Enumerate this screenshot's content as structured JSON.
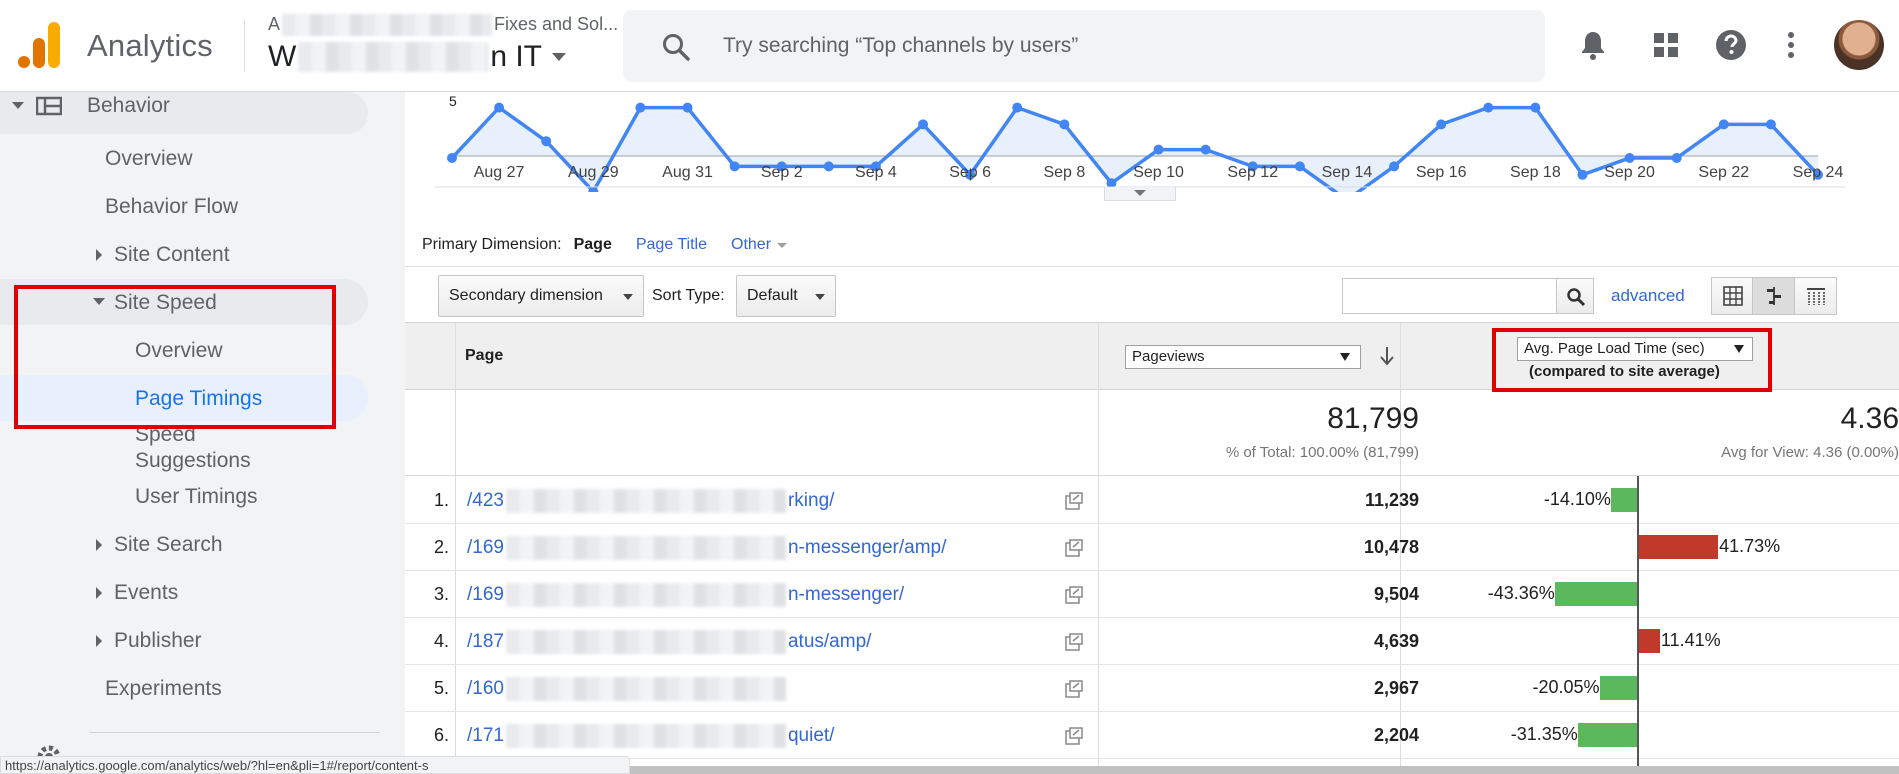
{
  "header": {
    "brand": "Analytics",
    "account_prefix": "A",
    "account_suffix": "Fixes and Sol...",
    "property_prefix": "W",
    "property_suffix": "n IT",
    "search_placeholder": "Try searching “Top channels by users”",
    "icons": [
      "search-icon",
      "bell-icon",
      "apps-icon",
      "help-icon",
      "more-vert-icon"
    ]
  },
  "sidebar": {
    "behavior": "Behavior",
    "overview": "Overview",
    "behavior_flow": "Behavior Flow",
    "site_content": "Site Content",
    "site_speed": "Site Speed",
    "speed_overview": "Overview",
    "page_timings": "Page Timings",
    "speed_suggestions_1": "Speed",
    "speed_suggestions_2": "Suggestions",
    "user_timings": "User Timings",
    "site_search": "Site Search",
    "events": "Events",
    "publisher": "Publisher",
    "experiments": "Experiments"
  },
  "chart_data": {
    "type": "line",
    "x": [
      "Aug 26",
      "Aug 27",
      "Aug 28",
      "Aug 29",
      "Aug 30",
      "Aug 31",
      "Sep 1",
      "Sep 2",
      "Sep 3",
      "Sep 4",
      "Sep 5",
      "Sep 6",
      "Sep 7",
      "Sep 8",
      "Sep 9",
      "Sep 10",
      "Sep 11",
      "Sep 12",
      "Sep 13",
      "Sep 14",
      "Sep 15",
      "Sep 16",
      "Sep 17",
      "Sep 18",
      "Sep 19",
      "Sep 20",
      "Sep 21",
      "Sep 22",
      "Sep 23",
      "Sep 24"
    ],
    "tick_labels": [
      "Aug 27",
      "Aug 29",
      "Aug 31",
      "Sep 2",
      "Sep 4",
      "Sep 6",
      "Sep 8",
      "Sep 10",
      "Sep 12",
      "Sep 14",
      "Sep 16",
      "Sep 18",
      "Sep 20",
      "Sep 22",
      "Sep 24"
    ],
    "y_axis_label": "5",
    "series": [
      {
        "values": [
          5,
          5.6,
          5.2,
          4.6,
          5.6,
          5.6,
          4.9,
          4.9,
          4.9,
          4.9,
          5.4,
          4.8,
          5.6,
          5.4,
          4.7,
          5.1,
          5.1,
          4.9,
          4.9,
          4.5,
          4.9,
          5.4,
          5.6,
          5.6,
          4.8,
          5.0,
          5.0,
          5.4,
          5.4,
          4.8
        ]
      }
    ],
    "ylim": [
      4,
      6
    ],
    "color": "#4285f4",
    "fill": "#e8f0fb",
    "grid": false
  },
  "dimensions": {
    "label": "Primary Dimension:",
    "active": "Page",
    "page_title": "Page Title",
    "other": "Other"
  },
  "controls": {
    "secondary_dimension": "Secondary dimension",
    "sort_type_label": "Sort Type:",
    "sort_type_value": "Default",
    "filter_value": "",
    "advanced": "advanced"
  },
  "table": {
    "col_page": "Page",
    "col_pageviews": "Pageviews",
    "col_metric": "Avg. Page Load Time (sec)",
    "col_metric_sub": "(compared to site average)",
    "total_pageviews": "81,799",
    "total_pageviews_sub": "% of Total: 100.00% (81,799)",
    "total_metric": "4.36",
    "total_metric_sub": "Avg for View: 4.36 (0.00%)",
    "rows": [
      {
        "num": "1.",
        "page_start": "/423",
        "page_end": "rking/",
        "pageviews": "11,239",
        "pct_label": "-14.10%",
        "pct": -14.1
      },
      {
        "num": "2.",
        "page_start": "/169",
        "page_end": "n-messenger/amp/",
        "pageviews": "10,478",
        "pct_label": "41.73%",
        "pct": 41.73
      },
      {
        "num": "3.",
        "page_start": "/169",
        "page_end": "n-messenger/",
        "pageviews": "9,504",
        "pct_label": "-43.36%",
        "pct": -43.36
      },
      {
        "num": "4.",
        "page_start": "/187",
        "page_end": "atus/amp/",
        "pageviews": "4,639",
        "pct_label": "11.41%",
        "pct": 11.41
      },
      {
        "num": "5.",
        "page_start": "/160",
        "page_end": "",
        "pageviews": "2,967",
        "pct_label": "-20.05%",
        "pct": -20.05
      },
      {
        "num": "6.",
        "page_start": "/171",
        "page_end": "quiet/",
        "pageviews": "2,204",
        "pct_label": "-31.35%",
        "pct": -31.35
      }
    ],
    "colors": {
      "negative": "#5cb85c",
      "positive": "#c0392b"
    }
  },
  "statusbar": "https://analytics.google.com/analytics/web/?hl=en&pli=1#/report/content-s"
}
